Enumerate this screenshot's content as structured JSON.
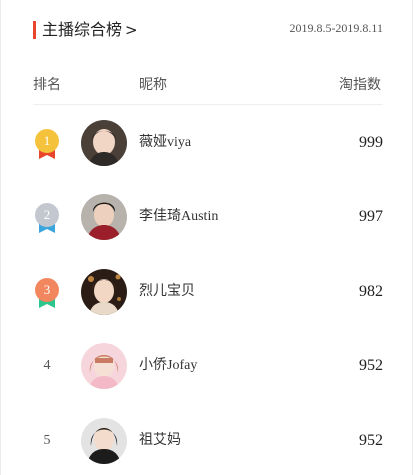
{
  "header": {
    "title": "主播综合榜",
    "title_chevron": ">",
    "date_range": "2019.8.5-2019.8.11",
    "accent_color": "#e8452c"
  },
  "columns": {
    "rank": "排名",
    "name": "昵称",
    "index": "淘指数"
  },
  "rows": [
    {
      "rank": "1",
      "name": "薇娅viya",
      "value": "999",
      "badge": "gold-medal-icon",
      "medal_color": "#f5c33b",
      "ribbon_color": "#e8452c"
    },
    {
      "rank": "2",
      "name": "李佳琦Austin",
      "value": "997",
      "badge": "silver-medal-icon",
      "medal_color": "#c3c7cf",
      "ribbon_color": "#3aa6dd"
    },
    {
      "rank": "3",
      "name": "烈儿宝贝",
      "value": "982",
      "badge": "bronze-medal-icon",
      "medal_color": "#f2875f",
      "ribbon_color": "#2cc58d"
    },
    {
      "rank": "4",
      "name": "小侨Jofay",
      "value": "952"
    },
    {
      "rank": "5",
      "name": "祖艾妈",
      "value": "952"
    }
  ]
}
